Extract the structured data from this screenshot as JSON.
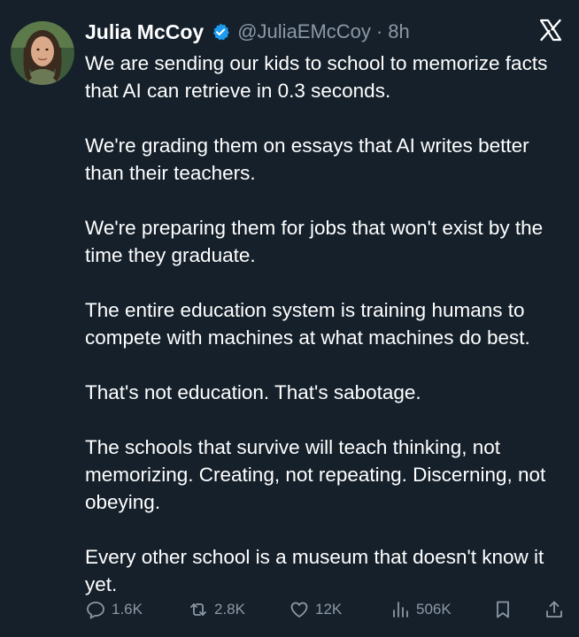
{
  "tweet": {
    "author": {
      "name": "Julia McCoy",
      "handle": "@JuliaEMcCoy",
      "separator": "·",
      "time": "8h",
      "verified": true
    },
    "platform_icon": "x-logo-icon",
    "paragraphs": [
      "We are sending our kids to school to memorize facts that AI can retrieve in 0.3 seconds.",
      "We're grading them on essays that AI writes better than their teachers.",
      "We're preparing them for jobs that won't exist by the time they graduate.",
      "The entire education system is training humans to compete with machines at what machines do best.",
      "That's not education. That's sabotage.",
      "The schools that survive will teach thinking, not memorizing. Creating, not repeating. Discerning, not obeying.",
      "Every other school is a museum that doesn't know it yet."
    ],
    "stats": {
      "replies": "1.6K",
      "reposts": "2.8K",
      "likes": "12K",
      "views": "506K"
    }
  },
  "colors": {
    "background": "#15202b",
    "text": "#ffffff",
    "secondary": "#8b98a5",
    "verified_blue": "#1d9bf0"
  }
}
